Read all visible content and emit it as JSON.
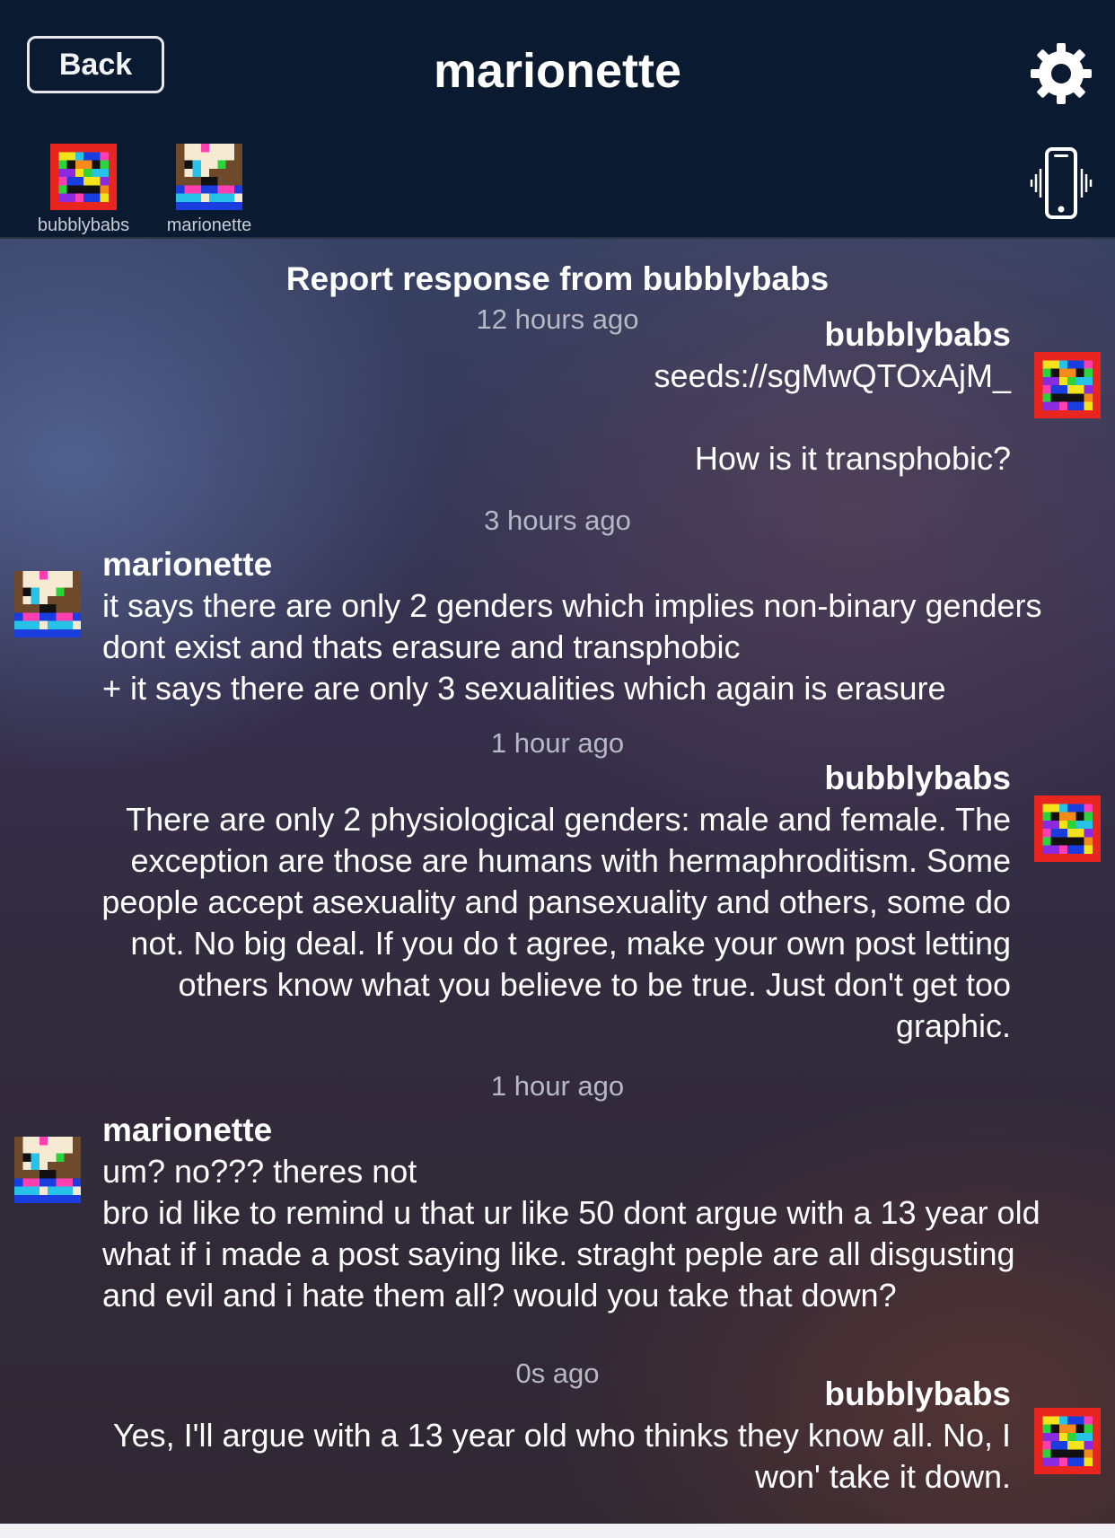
{
  "header": {
    "back_label": "Back",
    "title": "marionette",
    "settings_icon": "gear-icon",
    "vibrate_icon": "phone-vibrate-icon",
    "participants": [
      {
        "name": "bubblybabs"
      },
      {
        "name": "marionette"
      }
    ]
  },
  "thread": {
    "report_title": "Report response from bubblybabs",
    "report_time": "12 hours ago",
    "messages": [
      {
        "author": "bubblybabs",
        "text": "seeds://sgMwQTOxAjM_\n\nHow is it transphobic?"
      },
      {
        "time": "3 hours ago",
        "author": "marionette",
        "text": "it says there are only 2 genders which implies non-binary genders\ndont exist and thats erasure and transphobic\n+ it says there are only 3 sexualities which again is erasure"
      },
      {
        "time": "1 hour ago",
        "author": "bubblybabs",
        "text": "There are only 2 physiological genders: male and female.  The\nexception are those are humans with hermaphroditism.  Some\npeople accept asexuality and pansexuality and others, some do\nnot.  No big deal.  If you do t agree, make your own post letting\nothers know what you believe to be true.  Just don't get too\ngraphic."
      },
      {
        "time": "1 hour ago",
        "author": "marionette",
        "text": "um? no??? theres not\nbro id like to remind u that ur like 50 dont argue with a 13 year old\nwhat if i made a post saying like. straght peple are all disgusting\nand evil and i hate them all? would you take that down?"
      },
      {
        "time": "0s ago",
        "author": "bubblybabs",
        "text": "Yes, I'll argue with a 13 year old who thinks they know all.  No, I\nwon' take it down."
      }
    ]
  },
  "colors": {
    "header_bg": "#0a1a30",
    "text": "#ffffff",
    "timestamp": "#b6b9c4"
  }
}
